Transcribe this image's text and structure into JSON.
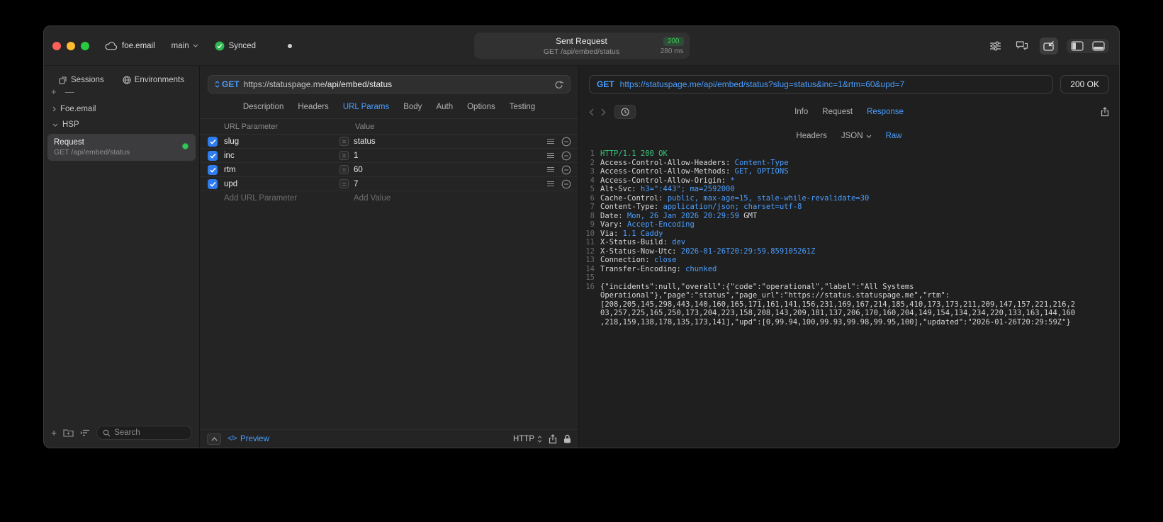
{
  "accent": {
    "blue": "#4a9eff",
    "green": "#32d74b"
  },
  "titlebar": {
    "project": "foe.email",
    "branch": "main",
    "sync_label": "Synced",
    "pill": {
      "title": "Sent Request",
      "status": "200",
      "subtitle": "GET /api/embed/status",
      "duration": "280 ms"
    }
  },
  "sidebar": {
    "tabs": [
      {
        "label": "Sessions"
      },
      {
        "label": "Environments"
      }
    ],
    "groups": [
      {
        "label": "Foe.email"
      },
      {
        "label": "HSP"
      }
    ],
    "request_item": {
      "title": "Request",
      "subtitle": "GET /api/embed/status"
    },
    "search_placeholder": "Search"
  },
  "request_pane": {
    "method": "GET",
    "url_host": "https://statuspage.me",
    "url_path": "/api/embed/status",
    "tabs": [
      "Description",
      "Headers",
      "URL Params",
      "Body",
      "Auth",
      "Options",
      "Testing"
    ],
    "active_tab": "URL Params",
    "table": {
      "col_param": "URL Parameter",
      "col_value": "Value",
      "rows": [
        {
          "name": "slug",
          "value": "status"
        },
        {
          "name": "inc",
          "value": "1"
        },
        {
          "name": "rtm",
          "value": "60"
        },
        {
          "name": "upd",
          "value": "7"
        }
      ],
      "add_param": "Add URL Parameter",
      "add_value": "Add Value"
    },
    "footer": {
      "code_glyph": "</>",
      "preview": "Preview",
      "protocol": "HTTP"
    }
  },
  "response_pane": {
    "method": "GET",
    "url": "https://statuspage.me/api/embed/status?slug=status&inc=1&rtm=60&upd=7",
    "status": "200 OK",
    "tabs": [
      "Info",
      "Request",
      "Response"
    ],
    "active_tab": "Response",
    "subtabs": [
      "Headers",
      "JSON",
      "Raw"
    ],
    "active_subtab": "Raw",
    "dropdown_subtab": "JSON",
    "body_lines": [
      {
        "n": 1,
        "segs": [
          {
            "t": "HTTP/1.1 200 OK",
            "c": "ok"
          }
        ]
      },
      {
        "n": 2,
        "segs": [
          {
            "t": "Access-Control-Allow-Headers: ",
            "c": "h"
          },
          {
            "t": "Content-Type",
            "c": "v"
          }
        ]
      },
      {
        "n": 3,
        "segs": [
          {
            "t": "Access-Control-Allow-Methods: ",
            "c": "h"
          },
          {
            "t": "GET, OPTIONS",
            "c": "v"
          }
        ]
      },
      {
        "n": 4,
        "segs": [
          {
            "t": "Access-Control-Allow-Origin: ",
            "c": "h"
          },
          {
            "t": "*",
            "c": "v"
          }
        ]
      },
      {
        "n": 5,
        "segs": [
          {
            "t": "Alt-Svc: ",
            "c": "h"
          },
          {
            "t": "h3=\":443\"; ma=2592000",
            "c": "v"
          }
        ]
      },
      {
        "n": 6,
        "segs": [
          {
            "t": "Cache-Control: ",
            "c": "h"
          },
          {
            "t": "public, max-age=15, stale-while-revalidate=30",
            "c": "v"
          }
        ]
      },
      {
        "n": 7,
        "segs": [
          {
            "t": "Content-Type: ",
            "c": "h"
          },
          {
            "t": "application/json; charset=utf-8",
            "c": "v"
          }
        ]
      },
      {
        "n": 8,
        "segs": [
          {
            "t": "Date: ",
            "c": "h"
          },
          {
            "t": "Mon, 26 Jan 2026 20:29:59",
            "c": "v"
          },
          {
            "t": " GMT",
            "c": "h"
          }
        ]
      },
      {
        "n": 9,
        "segs": [
          {
            "t": "Vary: ",
            "c": "h"
          },
          {
            "t": "Accept-Encoding",
            "c": "v"
          }
        ]
      },
      {
        "n": 10,
        "segs": [
          {
            "t": "Via: ",
            "c": "h"
          },
          {
            "t": "1.1 Caddy",
            "c": "v"
          }
        ]
      },
      {
        "n": 11,
        "segs": [
          {
            "t": "X-Status-Build: ",
            "c": "h"
          },
          {
            "t": "dev",
            "c": "v"
          }
        ]
      },
      {
        "n": 12,
        "segs": [
          {
            "t": "X-Status-Now-Utc: ",
            "c": "h"
          },
          {
            "t": "2026-01-26T20:29:59.859105261Z",
            "c": "v"
          }
        ]
      },
      {
        "n": 13,
        "segs": [
          {
            "t": "Connection: ",
            "c": "h"
          },
          {
            "t": "close",
            "c": "v"
          }
        ]
      },
      {
        "n": 14,
        "segs": [
          {
            "t": "Transfer-Encoding: ",
            "c": "h"
          },
          {
            "t": "chunked",
            "c": "v"
          }
        ]
      },
      {
        "n": 15,
        "segs": []
      },
      {
        "n": 16,
        "segs": [
          {
            "t": "{\"incidents\":null,\"overall\":{\"code\":\"operational\",\"label\":\"All Systems Operational\"},\"page\":\"status\",\"page_url\":\"https://status.statuspage.me\",\"rtm\":[208,205,145,298,443,140,160,165,171,161,141,156,231,169,167,214,185,410,173,173,211,209,147,157,221,216,203,257,225,165,250,173,204,223,158,208,143,209,181,137,206,170,160,204,149,154,134,234,220,133,163,144,160,218,159,138,178,135,173,141],\"upd\":[0,99.94,100,99.93,99.98,99.95,100],\"updated\":\"2026-01-26T20:29:59Z\"}",
            "c": "h"
          }
        ]
      }
    ]
  }
}
